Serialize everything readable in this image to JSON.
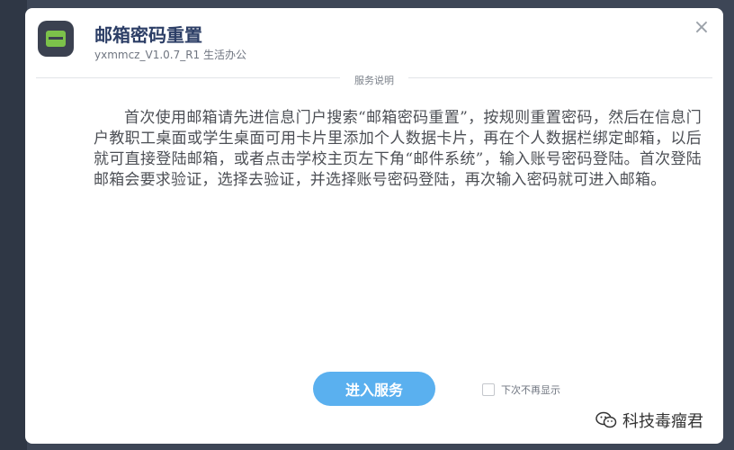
{
  "dialog": {
    "title": "邮箱密码重置",
    "subtitle": "yxmmcz_V1.0.7_R1 生活办公",
    "close_icon": "×",
    "section_label": "服务说明",
    "description": "首次使用邮箱请先进信息门户搜索“邮箱密码重置”，按规则重置密码，然后在信息门户教职工桌面或学生桌面可用卡片里添加个人数据卡片，再在个人数据栏绑定邮箱，以后就可直接登陆邮箱，或者点击学校主页左下角“邮件系统”，输入账号密码登陆。首次登陆邮箱会要求验证，选择去验证，并选择账号密码登陆，再次输入密码就可进入邮箱。",
    "enter_button": "进入服务",
    "no_show_label": "下次不再显示"
  },
  "watermark": {
    "text": "科技毒瘤君"
  },
  "colors": {
    "title": "#2c3e66",
    "button": "#5ab0ef",
    "app_icon_bg": "#3b4150",
    "app_icon_screen": "#7cc14a"
  },
  "icons": {
    "app": "app-screen-icon",
    "close": "close-icon",
    "watermark": "wechat-icon"
  }
}
